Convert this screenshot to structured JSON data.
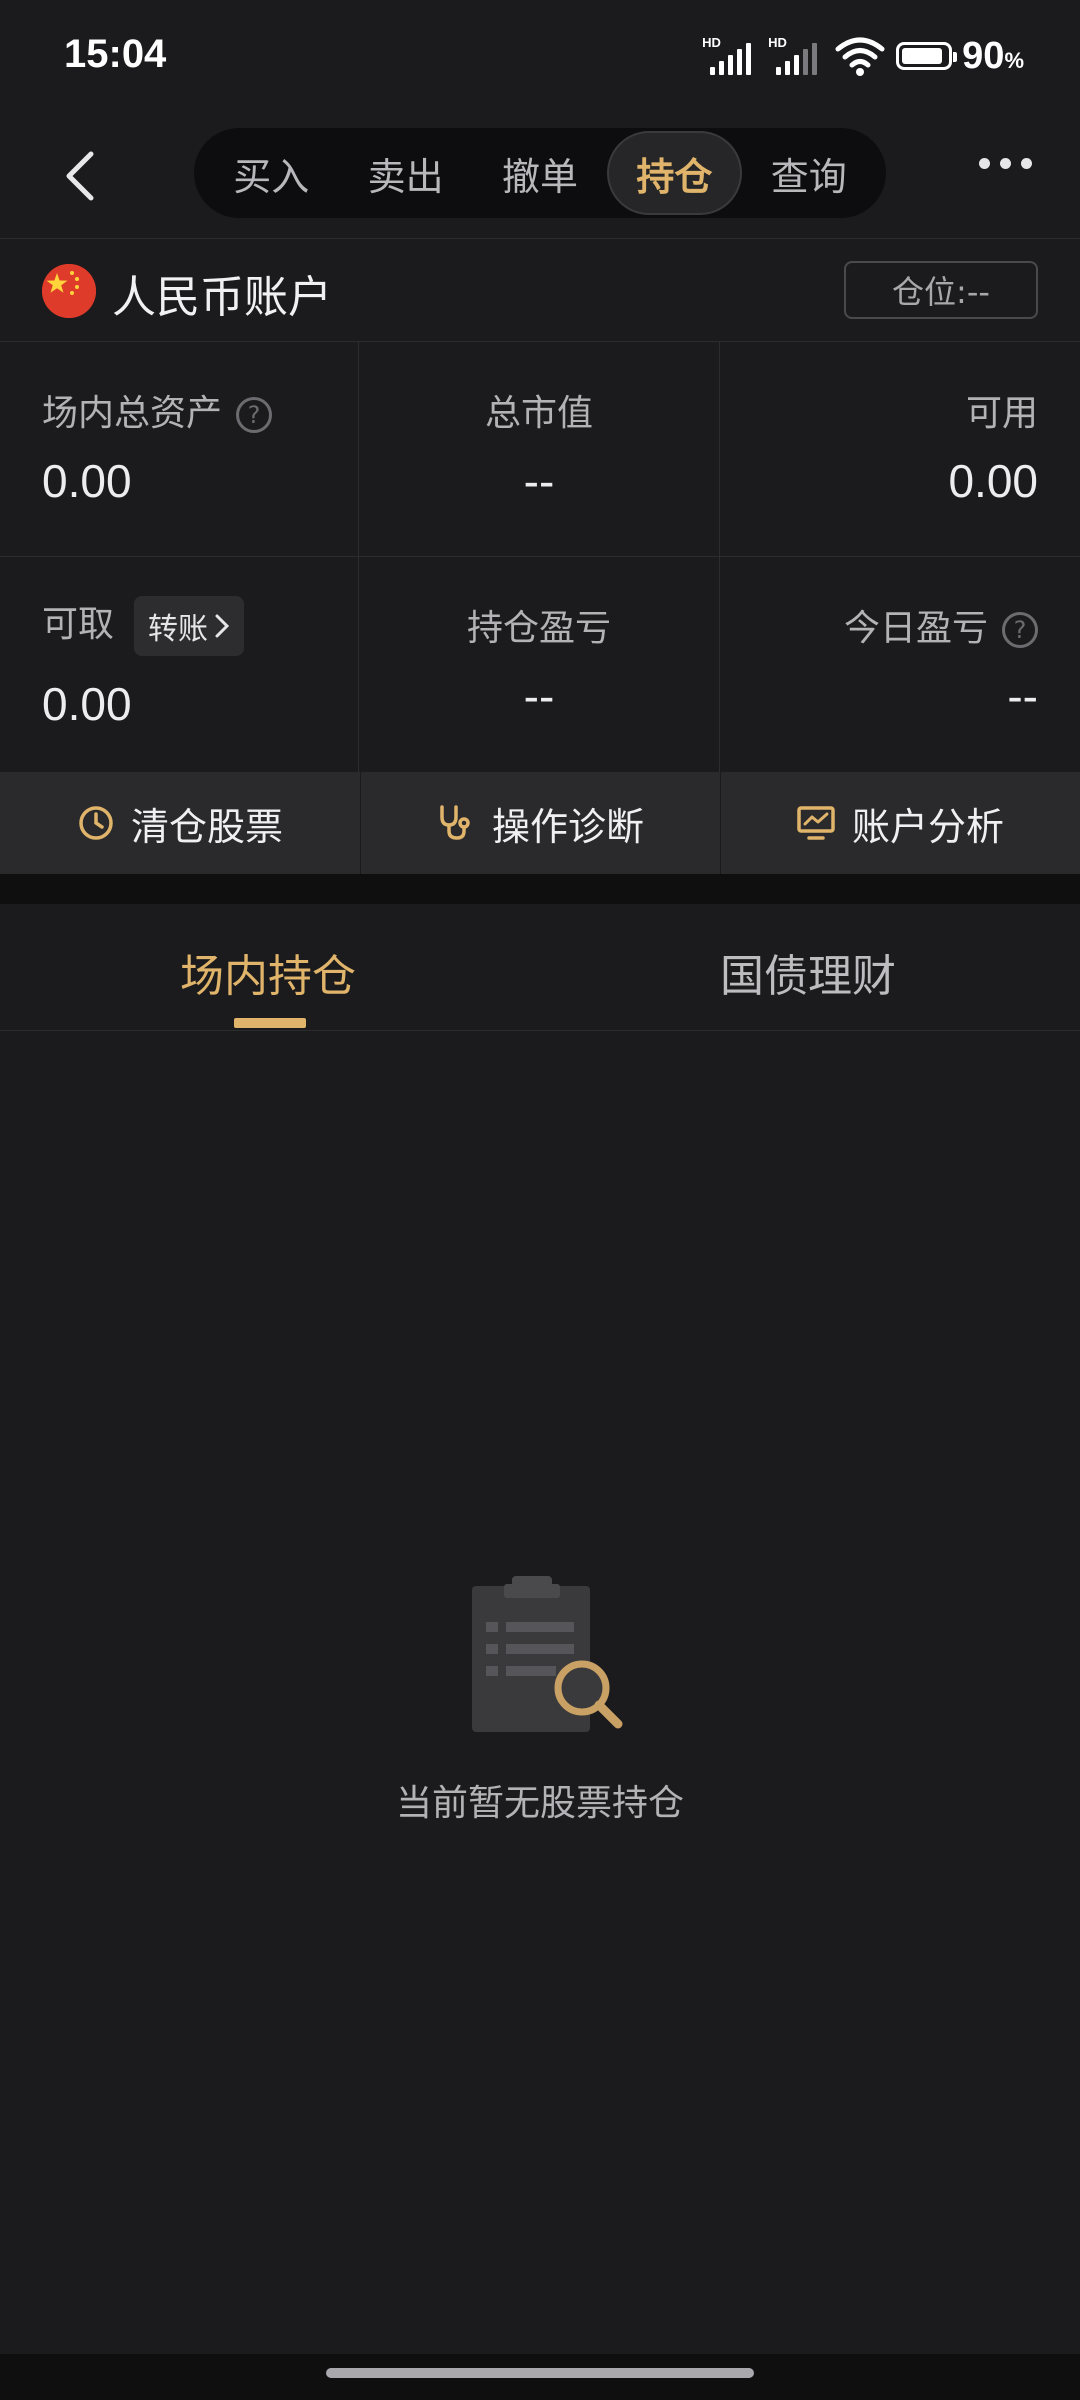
{
  "status_bar": {
    "time": "15:04",
    "hd1": "HD",
    "hd2": "HD",
    "battery_percent": "90",
    "battery_unit": "%",
    "battery_level": 0.9
  },
  "nav": {
    "tabs": [
      "买入",
      "卖出",
      "撤单",
      "持仓",
      "查询"
    ],
    "active_tab": "持仓",
    "accent_color": "#e0b46a"
  },
  "account": {
    "name": "人民币账户",
    "position_label": "仓位:--"
  },
  "stats": {
    "total_assets_label": "场内总资产",
    "total_assets_value": "0.00",
    "market_value_label": "总市值",
    "market_value_value": "--",
    "available_label": "可用",
    "available_value": "0.00",
    "withdrawable_label": "可取",
    "withdrawable_value": "0.00",
    "transfer_label": "转账",
    "holding_pl_label": "持仓盈亏",
    "holding_pl_value": "--",
    "today_pl_label": "今日盈亏",
    "today_pl_value": "--"
  },
  "actions": {
    "clear": "清仓股票",
    "diagnose": "操作诊断",
    "analysis": "账户分析"
  },
  "tabs": {
    "onsite": "场内持仓",
    "bonds": "国债理财"
  },
  "empty_state": {
    "message": "当前暂无股票持仓"
  }
}
